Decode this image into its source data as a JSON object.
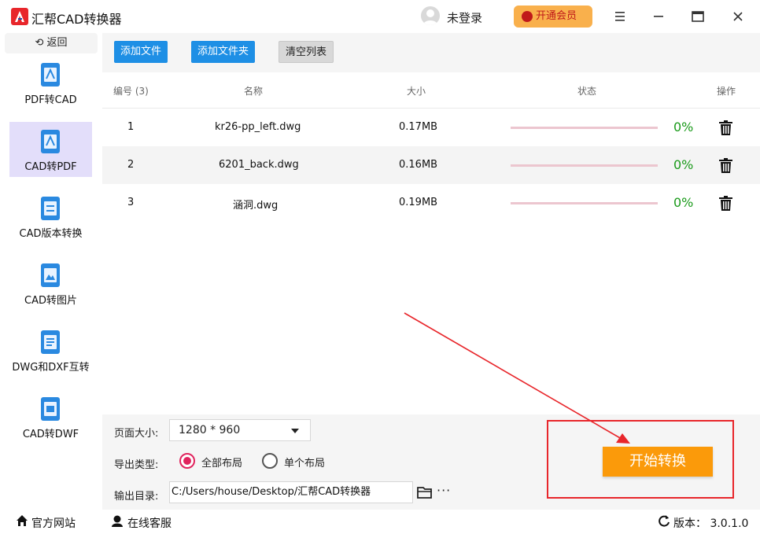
{
  "app": {
    "title": "汇帮CAD转换器"
  },
  "header": {
    "user_label": "未登录",
    "vip_label": "开通会员"
  },
  "sidebar": {
    "back_label": "返回",
    "items": [
      {
        "label": "PDF转CAD",
        "active": false
      },
      {
        "label": "CAD转PDF",
        "active": true
      },
      {
        "label": "CAD版本转换",
        "active": false
      },
      {
        "label": "CAD转图片",
        "active": false
      },
      {
        "label": "DWG和DXF互转",
        "active": false
      },
      {
        "label": "CAD转DWF",
        "active": false
      }
    ]
  },
  "toolbar": {
    "add_file": "添加文件",
    "add_folder": "添加文件夹",
    "clear_list": "清空列表"
  },
  "table": {
    "headers": {
      "index": "编号 (3)",
      "name": "名称",
      "size": "大小",
      "status": "状态",
      "action": "操作"
    },
    "rows": [
      {
        "index": "1",
        "name": "kr26-pp_left.dwg",
        "size": "0.17MB",
        "progress": "0%"
      },
      {
        "index": "2",
        "name": "6201_back.dwg",
        "size": "0.16MB",
        "progress": "0%"
      },
      {
        "index": "3",
        "name": "涵洞.dwg",
        "size": "0.19MB",
        "progress": "0%"
      }
    ]
  },
  "settings": {
    "page_size_label": "页面大小:",
    "page_size_value": "1280 * 960",
    "export_type_label": "导出类型:",
    "export_options": [
      "全部布局",
      "单个布局"
    ],
    "export_selected": "全部布局",
    "output_dir_label": "输出目录:",
    "output_dir_value": "C:/Users/house/Desktop/汇帮CAD转换器",
    "more_label": "···"
  },
  "start_button": "开始转换",
  "footer": {
    "website": "官方网站",
    "support": "在线客服",
    "version": "版本： 3.0.1.0"
  },
  "colors": {
    "primary": "#1e8fe5",
    "start": "#fb9a0a",
    "active_nav": "#e3defa",
    "highlight": "#e8262b",
    "progress_text": "#1a9a1a"
  }
}
